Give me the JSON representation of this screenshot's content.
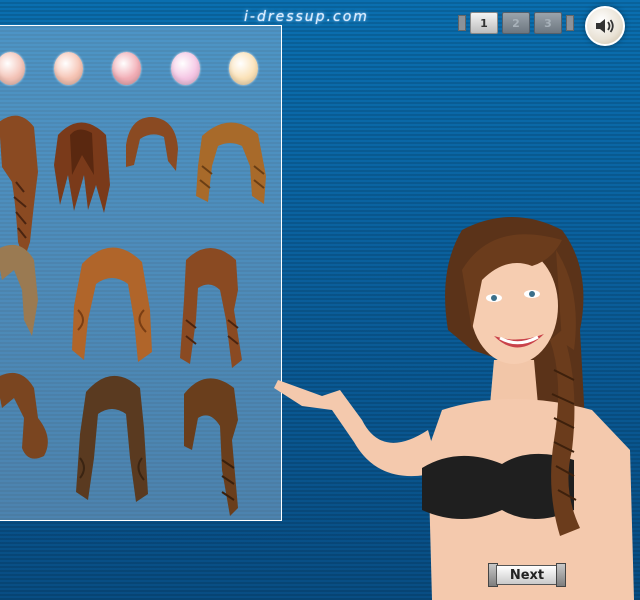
{
  "site_logo": "i-dressup.com",
  "page_tabs": [
    "1",
    "2",
    "3"
  ],
  "active_page": "1",
  "next_label": "Next",
  "icons": {
    "sound": "speaker-icon"
  },
  "hair_colors": [
    "#f4c4b8",
    "#f6c4b4",
    "#f2aeb6",
    "#f5c6e4",
    "#fbe2b8"
  ],
  "hairstyles": [
    {
      "name": "long-braid",
      "color": "#8a4a22"
    },
    {
      "name": "long-straight",
      "color": "#7a3a1a"
    },
    {
      "name": "short-bob",
      "color": "#8a4a22"
    },
    {
      "name": "double-braid",
      "color": "#a86a2a"
    },
    {
      "name": "wavy-blonde-brown",
      "color": "#9a7a52"
    },
    {
      "name": "long-wavy",
      "color": "#b0652a"
    },
    {
      "name": "side-braid",
      "color": "#8a4a22"
    },
    {
      "name": "curly-short",
      "color": "#7a4520"
    },
    {
      "name": "wavy-dark",
      "color": "#5a3a20"
    },
    {
      "name": "braided-tail",
      "color": "#6a3e1c"
    }
  ]
}
